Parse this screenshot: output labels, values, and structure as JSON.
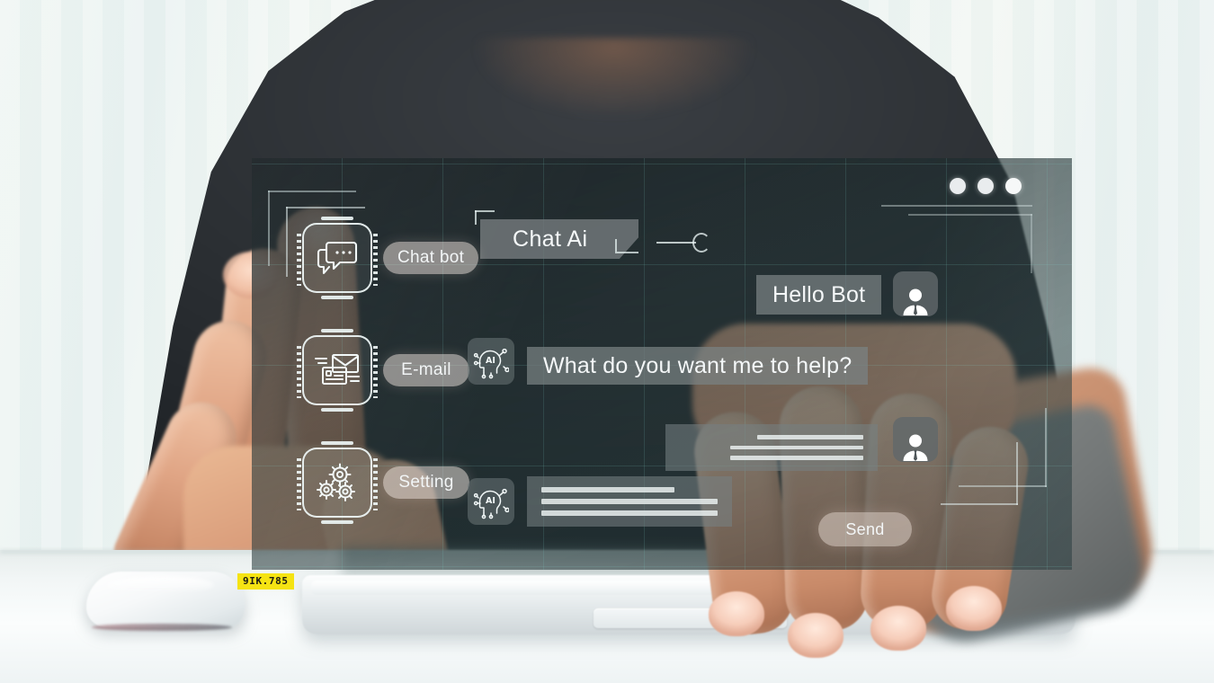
{
  "app": {
    "title": "Chat Ai",
    "window_controls": [
      "minimize-dot",
      "maximize-dot",
      "close-dot"
    ]
  },
  "sidebar": {
    "items": [
      {
        "label": "Chat bot",
        "icon": "chat-bubble-icon"
      },
      {
        "label": "E-mail",
        "icon": "email-envelope-icon"
      },
      {
        "label": "Setting",
        "icon": "gears-icon"
      }
    ]
  },
  "assistant_badges": [
    {
      "icon": "ai-head-icon",
      "label": "AI"
    },
    {
      "icon": "ai-head-icon",
      "label": "AI"
    }
  ],
  "conversation": [
    {
      "id": "msg-user-1",
      "from": "user",
      "type": "text",
      "text": "Hello Bot",
      "avatar": "user-avatar-icon"
    },
    {
      "id": "msg-bot-1",
      "from": "bot",
      "type": "text",
      "text": "What do you want me to help?",
      "avatar": "ai-head-icon"
    },
    {
      "id": "msg-user-2",
      "from": "user",
      "type": "lines",
      "lines": [
        118,
        148,
        148
      ],
      "avatar": "user-avatar-icon"
    },
    {
      "id": "msg-bot-2",
      "from": "bot",
      "type": "lines",
      "lines": [
        148,
        196,
        196
      ],
      "avatar": "ai-head-icon"
    }
  ],
  "composer": {
    "send_label": "Send"
  },
  "desk": {
    "keyboard_badge": "9IK.785"
  },
  "colors": {
    "panel_bg": "#1e2e30",
    "grid_line": "#78c8be",
    "bubble": "#7a8284",
    "pill": "#f8ece6",
    "accent_badge": "#f5e313",
    "text": "#f4f7f8"
  }
}
